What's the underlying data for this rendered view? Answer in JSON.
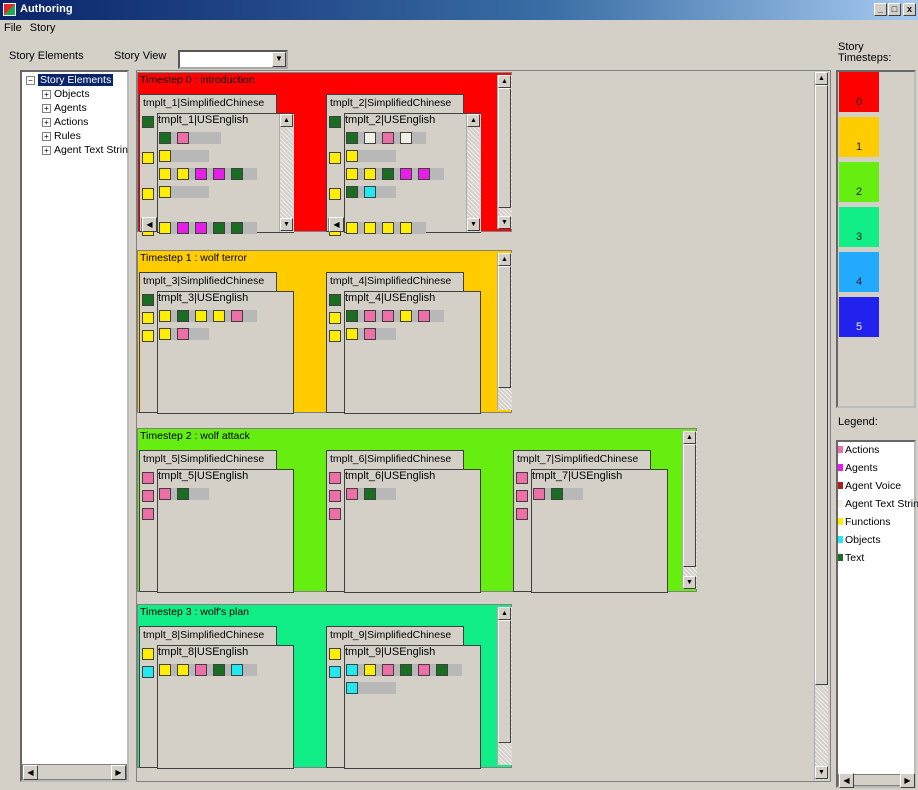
{
  "window": {
    "title": "Authoring",
    "min": "_",
    "max": "□",
    "close": "x"
  },
  "menu": {
    "file": "File",
    "story": "Story"
  },
  "labels": {
    "story_elements": "Story Elements",
    "story_view": "Story View",
    "story_timesteps": "Story Timesteps:",
    "legend": "Legend:"
  },
  "story_view_combo": {
    "value": ""
  },
  "tree": {
    "root": "Story Elements",
    "items": [
      "Objects",
      "Agents",
      "Actions",
      "Rules",
      "Agent Text Strin"
    ]
  },
  "colors": {
    "actions": "#ee6ea8",
    "agents": "#e81ee8",
    "agent_voice": "#b01c1c",
    "agent_text": "#f0f0e8",
    "functions": "#ffee00",
    "objects": "#22e8f0",
    "text": "#1a6e22"
  },
  "timesteps": [
    {
      "title": "Timestep 0 : introduction",
      "color": "#ff0000"
    },
    {
      "title": "Timestep 1 : wolf terror",
      "color": "#ffcc00"
    },
    {
      "title": "Timestep 2 : wolf attack",
      "color": "#66ee11"
    },
    {
      "title": "Timestep 3 : wolf's plan",
      "color": "#11ee88"
    }
  ],
  "templates": [
    {
      "outer": "tmplt_1|SimplifiedChinese",
      "inner": "tmplt_1|USEnglish"
    },
    {
      "outer": "tmplt_2|SimplifiedChinese",
      "inner": "tmplt_2|USEnglish"
    },
    {
      "outer": "tmplt_3|SimplifiedChinese",
      "inner": "tmplt_3|USEnglish"
    },
    {
      "outer": "tmplt_4|SimplifiedChinese",
      "inner": "tmplt_4|USEnglish"
    },
    {
      "outer": "tmplt_5|SimplifiedChinese",
      "inner": "tmplt_5|USEnglish"
    },
    {
      "outer": "tmplt_6|SimplifiedChinese",
      "inner": "tmplt_6|USEnglish"
    },
    {
      "outer": "tmplt_7|SimplifiedChinese",
      "inner": "tmplt_7|USEnglish"
    },
    {
      "outer": "tmplt_8|SimplifiedChinese",
      "inner": "tmplt_8|USEnglish"
    },
    {
      "outer": "tmplt_9|SimplifiedChinese",
      "inner": "tmplt_9|USEnglish"
    }
  ],
  "story_timesteps": [
    {
      "label": "0",
      "color": "#ff0000"
    },
    {
      "label": "1",
      "color": "#ffcc00"
    },
    {
      "label": "2",
      "color": "#66ee11"
    },
    {
      "label": "3",
      "color": "#11ee88"
    },
    {
      "label": "4",
      "color": "#22aaff"
    },
    {
      "label": "5",
      "color": "#2222ee"
    }
  ],
  "legend_items": [
    {
      "label": "Actions",
      "color": "#ee6ea8"
    },
    {
      "label": "Agents",
      "color": "#e81ee8"
    },
    {
      "label": "Agent Voice",
      "color": "#b01c1c"
    },
    {
      "label": "Agent Text Strin",
      "color": "#f0f0e8"
    },
    {
      "label": "Functions",
      "color": "#ffee00"
    },
    {
      "label": "Objects",
      "color": "#22e8f0"
    },
    {
      "label": "Text",
      "color": "#1a6e22"
    }
  ]
}
